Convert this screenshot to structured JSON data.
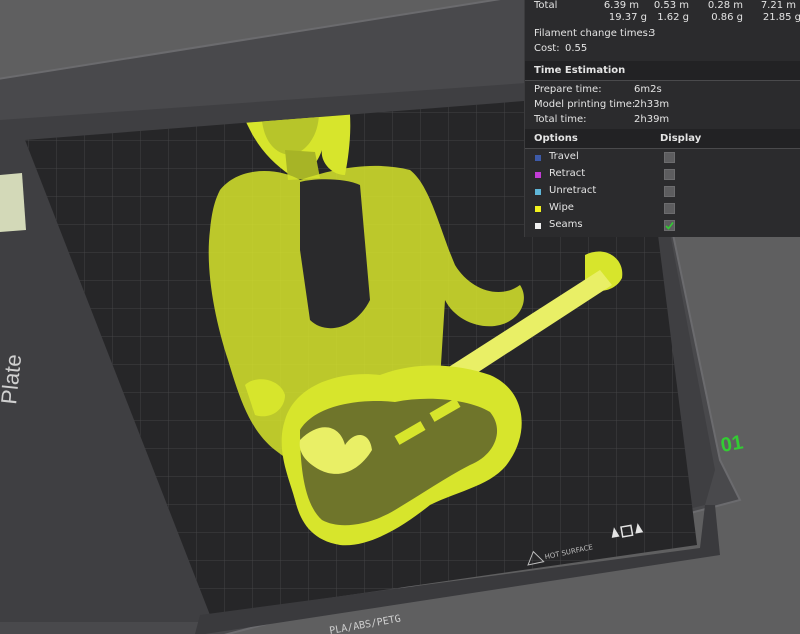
{
  "stats": {
    "total_label": "Total",
    "totals_m": [
      "6.39 m",
      "0.53 m",
      "0.28 m",
      "7.21 m"
    ],
    "totals_g": [
      "19.37 g",
      "1.62 g",
      "0.86 g",
      "21.85 g"
    ],
    "filament_change_label": "Filament change times:",
    "filament_change_value": "3",
    "cost_label": "Cost:",
    "cost_value": "0.55"
  },
  "time_estimation": {
    "title": "Time Estimation",
    "rows": [
      {
        "label": "Prepare time:",
        "value": "6m2s"
      },
      {
        "label": "Model printing time:",
        "value": "2h33m"
      },
      {
        "label": "Total time:",
        "value": "2h39m"
      }
    ]
  },
  "options": {
    "options_header": "Options",
    "display_header": "Display",
    "items": [
      {
        "label": "Travel",
        "color": "#3d5aa8",
        "checked": false
      },
      {
        "label": "Retract",
        "color": "#c23cd6",
        "checked": false
      },
      {
        "label": "Unretract",
        "color": "#5fb6d8",
        "checked": false
      },
      {
        "label": "Wipe",
        "color": "#f2f21e",
        "checked": false
      },
      {
        "label": "Seams",
        "color": "#f0f0f0",
        "checked": true
      }
    ]
  },
  "plate": {
    "label": "Plate",
    "number": "01",
    "bed_text": "PLA/ABS/PETG",
    "hot_surface_text": "HOT SURFACE",
    "accent_color": "#33cc33"
  },
  "colors": {
    "background": "#5f5f60",
    "panel": "#2b2b2d",
    "print": "#d7e52c",
    "bed": "#262628"
  }
}
